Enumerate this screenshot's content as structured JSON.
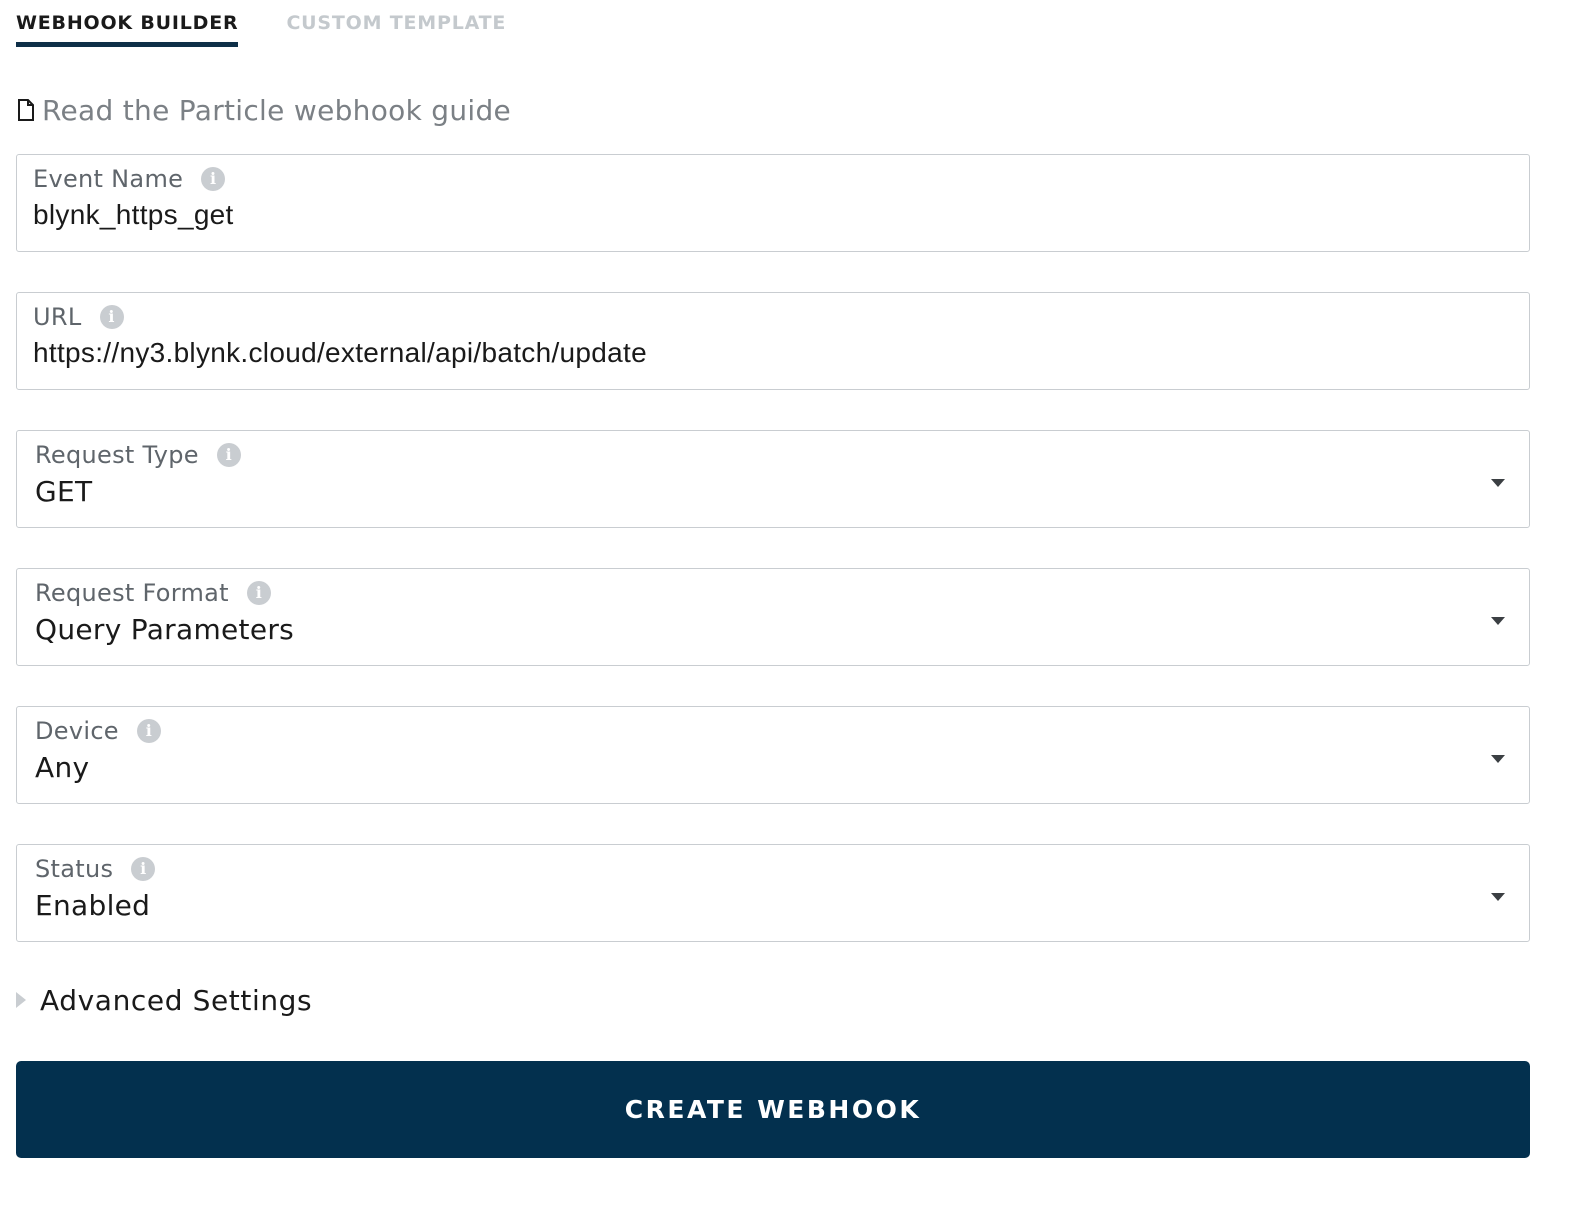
{
  "tabs": [
    {
      "label": "WEBHOOK BUILDER",
      "active": true
    },
    {
      "label": "CUSTOM TEMPLATE",
      "active": false
    }
  ],
  "guide_link": {
    "label": "Read the Particle webhook guide",
    "icon": "document-icon"
  },
  "fields": {
    "event_name": {
      "label": "Event Name",
      "value": "blynk_https_get"
    },
    "url": {
      "label": "URL",
      "value": "https://ny3.blynk.cloud/external/api/batch/update"
    },
    "request_type": {
      "label": "Request Type",
      "value": "GET"
    },
    "request_format": {
      "label": "Request Format",
      "value": "Query Parameters"
    },
    "device": {
      "label": "Device",
      "value": "Any"
    },
    "status": {
      "label": "Status",
      "value": "Enabled"
    }
  },
  "advanced_settings": {
    "label": "Advanced Settings",
    "expanded": false
  },
  "create_button": {
    "label": "CREATE WEBHOOK"
  },
  "colors": {
    "accent": "#0e2f48",
    "button_bg": "#03304e",
    "border": "#c9cdd1",
    "muted_text": "#7b8085"
  }
}
